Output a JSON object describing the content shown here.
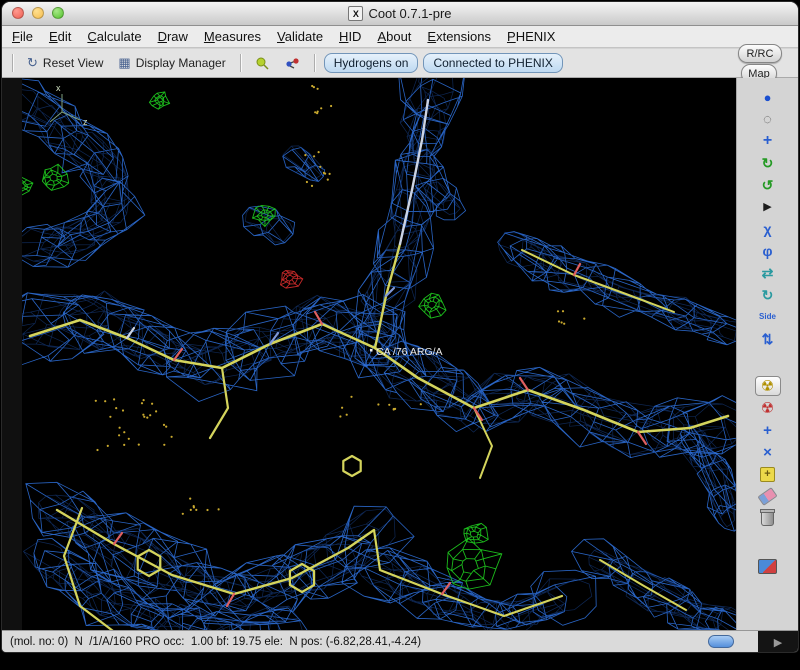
{
  "window": {
    "title": "Coot 0.7.1-pre",
    "icon_glyph": "X"
  },
  "menubar": {
    "items": [
      {
        "label": "File"
      },
      {
        "label": "Edit"
      },
      {
        "label": "Calculate"
      },
      {
        "label": "Draw"
      },
      {
        "label": "Measures"
      },
      {
        "label": "Validate"
      },
      {
        "label": "HID"
      },
      {
        "label": "About"
      },
      {
        "label": "Extensions"
      },
      {
        "label": "PHENIX"
      }
    ]
  },
  "toolbar": {
    "reset_view": "Reset View",
    "display_manager": "Display Manager",
    "hydrogens_toggle": "Hydrogens on",
    "phenix_toggle": "Connected to PHENIX",
    "icons": [
      {
        "name": "reset-view-icon",
        "glyph": "↻"
      },
      {
        "name": "display-manager-icon",
        "glyph": "▦"
      },
      {
        "name": "goto-atom-icon",
        "glyph": "svg"
      },
      {
        "name": "goto-ligand-icon",
        "glyph": "svg"
      }
    ]
  },
  "side_buttons": {
    "rrc": "R/RC",
    "map": "Map"
  },
  "right_toolbar": {
    "icons": [
      {
        "name": "sphere-icon",
        "glyph": "●"
      },
      {
        "name": "dashed-circle-icon",
        "glyph": "◌"
      },
      {
        "name": "translate-zone-icon",
        "glyph": "+"
      },
      {
        "name": "rotate-translate-icon",
        "glyph": "↻"
      },
      {
        "name": "auto-fit-rotamer-icon",
        "glyph": "↺"
      },
      {
        "name": "play-icon",
        "glyph": "▶"
      },
      {
        "name": "rotamers-icon",
        "glyph": "χ"
      },
      {
        "name": "edit-chi-angles-icon",
        "glyph": "φ"
      },
      {
        "name": "flip-peptide-icon",
        "glyph": "⇄"
      },
      {
        "name": "cycle-conformer-icon",
        "glyph": "↻"
      },
      {
        "name": "side-chain-flip-icon",
        "glyph": "Side"
      },
      {
        "name": "mutate-icon",
        "glyph": "⇅"
      },
      {
        "name": "refine-icon",
        "glyph": "☢",
        "selected": true
      },
      {
        "name": "regularize-icon",
        "glyph": "☢"
      },
      {
        "name": "fixed-atoms-icon",
        "glyph": "+"
      },
      {
        "name": "rigid-body-fit-icon",
        "glyph": "×"
      },
      {
        "name": "add-terminal-residue-icon",
        "glyph": "+"
      },
      {
        "name": "eraser-icon",
        "glyph": ""
      },
      {
        "name": "trash-icon",
        "glyph": ""
      },
      {
        "name": "picture-icon",
        "glyph": ""
      }
    ]
  },
  "canvas": {
    "atom_label": "CA /76 ARG/A",
    "axes": {
      "x": "x",
      "z": "z"
    }
  },
  "statusbar": {
    "text": "(mol. no: 0)  N  /1/A/160 PRO occ:  1.00 bf: 19.75 ele:  N pos: (-6.82,28.41,-4.24)",
    "grip_glyph": "▶"
  },
  "colors": {
    "map_mesh": "#2e6fd8",
    "map_mesh_dark": "#1c4ea6",
    "model": "#d4d45c",
    "model_light": "#ccd4e4",
    "positive_density": "#1ec41e",
    "negative_density": "#cc2a2a",
    "oxygen_tip": "#e06060",
    "nitrogen_tip": "#8098d8",
    "dots": "#c9a92e",
    "toggle_fill": "#cfe2f6",
    "selected_highlight": "#f2f2f2"
  }
}
